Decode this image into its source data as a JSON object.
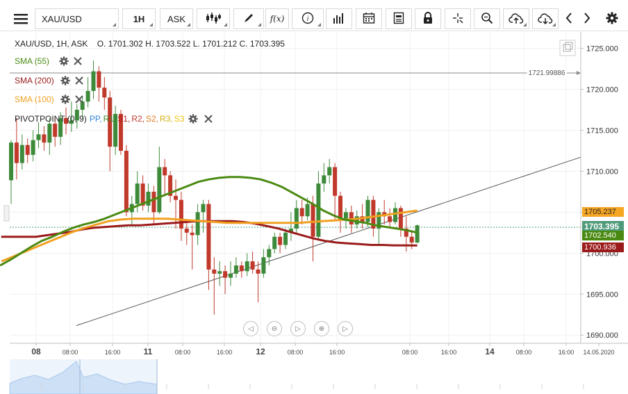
{
  "toolbar": {
    "symbol": "XAU/USD",
    "timeframe": "1H",
    "price_side": "ASK",
    "fx_label": "f(x)"
  },
  "ohlc_line": "XAU/USD, 1H, ASK    O. 1701.302 H. 1703.522 L. 1701.212 C. 1703.395",
  "indicators": {
    "sma55": "SMA (55)",
    "sma200": "SMA (200)",
    "sma100": "SMA (100)",
    "pivot": "PIVOTPOINT (0, 9)",
    "pivot_levels": [
      "PP,",
      "R1,",
      "S1,",
      "R2,",
      "S2,",
      "R3,",
      "S3"
    ]
  },
  "colors": {
    "sma55": "#4a8a12",
    "sma200": "#9b1a1a",
    "sma100": "#f0a020",
    "bull": "#3d8a3a",
    "bear": "#c0392b",
    "pp": "#2e86de",
    "r": "#3a8a2a",
    "s": "#b71c1c",
    "r2": "#c0392b",
    "s2": "#e67e22",
    "r3": "#d4ac0d",
    "s3": "#f1c40f"
  },
  "price_axis": {
    "ticks": [
      "1725.000",
      "1720.000",
      "1715.000",
      "1710.000",
      "1705.000",
      "1700.000",
      "1695.000",
      "1690.000"
    ],
    "tick_values": [
      1725,
      1720,
      1715,
      1710,
      1705,
      1700,
      1695,
      1690
    ],
    "current_price": "1703.395",
    "sma100_price": "1705.237",
    "sma55_price": "1702.540",
    "sma200_price": "1700.936",
    "hline_label": "1721.99886"
  },
  "time_axis": {
    "labels": [
      "08",
      "08:00",
      "16:00",
      "11",
      "08:00",
      "16:00",
      "12",
      "08:00",
      "16:00",
      "08:00",
      "16:00",
      "14",
      "08:00",
      "16:00",
      "14.05.2020"
    ]
  },
  "chart_data": {
    "type": "candlestick",
    "symbol": "XAU/USD",
    "interval": "1H",
    "ylim": [
      1689,
      1727
    ],
    "candles": [
      [
        1708.9,
        1713.5,
        1713.8,
        1706.0
      ],
      [
        1713.5,
        1711.0,
        1716.5,
        1709.0
      ],
      [
        1711.0,
        1713.2,
        1714.5,
        1710.2
      ],
      [
        1713.2,
        1712.0,
        1714.0,
        1711.0
      ],
      [
        1712.0,
        1713.8,
        1715.0,
        1711.2
      ],
      [
        1713.8,
        1714.5,
        1716.0,
        1712.8
      ],
      [
        1714.5,
        1713.5,
        1715.5,
        1712.5
      ],
      [
        1713.5,
        1715.8,
        1716.5,
        1712.0
      ],
      [
        1715.8,
        1714.2,
        1716.5,
        1713.0
      ],
      [
        1714.2,
        1716.5,
        1717.2,
        1713.2
      ],
      [
        1716.5,
        1715.8,
        1717.8,
        1714.5
      ],
      [
        1715.8,
        1716.2,
        1718.5,
        1714.8
      ],
      [
        1716.2,
        1717.5,
        1718.2,
        1715.2
      ],
      [
        1717.5,
        1718.5,
        1719.2,
        1716.5
      ],
      [
        1718.5,
        1719.8,
        1721.5,
        1717.8
      ],
      [
        1719.8,
        1722.2,
        1723.5,
        1718.8
      ],
      [
        1722.2,
        1720.2,
        1722.8,
        1718.5
      ],
      [
        1720.2,
        1719.0,
        1721.5,
        1717.5
      ],
      [
        1719.0,
        1713.0,
        1719.8,
        1710.0
      ],
      [
        1713.0,
        1717.0,
        1718.0,
        1712.0
      ],
      [
        1717.0,
        1712.5,
        1717.5,
        1712.0
      ],
      [
        1712.5,
        1705.0,
        1713.2,
        1704.5
      ],
      [
        1705.0,
        1706.0,
        1707.0,
        1703.5
      ],
      [
        1706.0,
        1708.5,
        1710.0,
        1705.0
      ],
      [
        1708.5,
        1705.8,
        1709.5,
        1705.2
      ],
      [
        1705.8,
        1707.5,
        1708.5,
        1705.0
      ],
      [
        1707.5,
        1705.0,
        1708.2,
        1703.5
      ],
      [
        1705.0,
        1710.5,
        1713.0,
        1704.8
      ],
      [
        1710.5,
        1709.5,
        1711.5,
        1707.0
      ],
      [
        1709.5,
        1707.0,
        1710.0,
        1706.2
      ],
      [
        1707.0,
        1706.5,
        1709.0,
        1703.0
      ],
      [
        1706.5,
        1703.0,
        1707.5,
        1701.5
      ],
      [
        1703.0,
        1702.5,
        1704.0,
        1701.0
      ],
      [
        1702.5,
        1702.2,
        1703.5,
        1698.0
      ],
      [
        1702.2,
        1705.0,
        1706.0,
        1701.0
      ],
      [
        1705.0,
        1706.0,
        1706.5,
        1702.5
      ],
      [
        1706.0,
        1698.0,
        1706.5,
        1695.5
      ],
      [
        1698.0,
        1697.5,
        1699.5,
        1692.5
      ],
      [
        1697.5,
        1697.8,
        1699.0,
        1696.0
      ],
      [
        1697.8,
        1697.0,
        1698.5,
        1695.0
      ],
      [
        1697.0,
        1697.5,
        1699.0,
        1696.0
      ],
      [
        1697.5,
        1698.5,
        1699.5,
        1697.0
      ],
      [
        1698.5,
        1697.8,
        1699.0,
        1697.0
      ],
      [
        1697.8,
        1699.0,
        1700.0,
        1697.2
      ],
      [
        1699.0,
        1698.0,
        1700.2,
        1697.5
      ],
      [
        1698.0,
        1697.5,
        1699.0,
        1694.0
      ],
      [
        1697.5,
        1699.5,
        1700.5,
        1697.0
      ],
      [
        1699.5,
        1700.5,
        1701.0,
        1698.5
      ],
      [
        1700.5,
        1702.0,
        1702.5,
        1700.0
      ],
      [
        1702.0,
        1701.0,
        1702.5,
        1700.0
      ],
      [
        1701.0,
        1702.5,
        1703.0,
        1700.5
      ],
      [
        1702.5,
        1703.0,
        1705.0,
        1701.5
      ],
      [
        1703.0,
        1705.5,
        1706.5,
        1702.5
      ],
      [
        1705.5,
        1704.5,
        1706.5,
        1703.5
      ],
      [
        1704.5,
        1706.0,
        1706.8,
        1704.0
      ],
      [
        1706.0,
        1702.0,
        1707.0,
        1699.0
      ],
      [
        1702.0,
        1708.5,
        1710.0,
        1701.5
      ],
      [
        1708.5,
        1709.5,
        1711.0,
        1707.5
      ],
      [
        1709.5,
        1710.5,
        1711.5,
        1708.5
      ],
      [
        1710.5,
        1707.0,
        1711.0,
        1704.0
      ],
      [
        1707.0,
        1704.0,
        1707.5,
        1702.5
      ],
      [
        1704.0,
        1705.0,
        1705.5,
        1703.0
      ],
      [
        1705.0,
        1703.5,
        1705.8,
        1702.5
      ],
      [
        1703.5,
        1704.5,
        1705.2,
        1703.0
      ],
      [
        1704.5,
        1703.8,
        1706.0,
        1703.0
      ],
      [
        1703.8,
        1706.5,
        1707.0,
        1703.2
      ],
      [
        1706.5,
        1703.0,
        1707.0,
        1702.0
      ],
      [
        1703.0,
        1705.0,
        1705.5,
        1701.0
      ],
      [
        1705.0,
        1704.5,
        1706.5,
        1703.5
      ],
      [
        1704.5,
        1703.8,
        1705.5,
        1703.0
      ],
      [
        1703.8,
        1705.5,
        1706.2,
        1703.5
      ],
      [
        1705.5,
        1703.0,
        1705.8,
        1702.0
      ],
      [
        1703.0,
        1702.0,
        1704.5,
        1700.2
      ],
      [
        1702.0,
        1701.3,
        1702.8,
        1700.5
      ],
      [
        1701.3,
        1703.4,
        1703.5,
        1701.2
      ]
    ],
    "sma55": [
      1698.5,
      1699.2,
      1700.0,
      1700.8,
      1701.5,
      1702.0,
      1702.6,
      1703.1,
      1703.5,
      1703.8,
      1704.2,
      1704.7,
      1705.2,
      1705.7,
      1706.2,
      1706.7,
      1707.2,
      1707.7,
      1708.2,
      1708.7,
      1709.0,
      1709.2,
      1709.3,
      1709.3,
      1709.2,
      1709.0,
      1708.6,
      1708.1,
      1707.4,
      1706.7,
      1706.0,
      1705.2,
      1704.6,
      1704.1,
      1703.9,
      1703.7,
      1703.4,
      1703.2,
      1703.0,
      1702.8,
      1702.5
    ],
    "sma200": [
      1702.0,
      1702.0,
      1702.0,
      1702.0,
      1702.2,
      1702.4,
      1702.6,
      1702.9,
      1703.1,
      1703.2,
      1703.3,
      1703.4,
      1703.4,
      1703.5,
      1703.6,
      1703.7,
      1703.8,
      1703.9,
      1703.9,
      1703.9,
      1703.9,
      1703.8,
      1703.6,
      1703.3,
      1703.0,
      1702.6,
      1702.2,
      1701.8,
      1701.5,
      1701.3,
      1701.2,
      1701.1,
      1701.0,
      1701.0,
      1700.95,
      1700.95,
      1700.94
    ],
    "sma100": [
      1699.0,
      1699.6,
      1700.2,
      1700.8,
      1701.4,
      1702.0,
      1702.6,
      1703.1,
      1703.5,
      1703.9,
      1704.1,
      1704.2,
      1704.2,
      1704.2,
      1704.2,
      1704.1,
      1704.0,
      1703.9,
      1703.8,
      1703.7,
      1703.7,
      1703.7,
      1703.7,
      1703.7,
      1703.7,
      1703.7,
      1703.8,
      1703.9,
      1704.0,
      1704.1,
      1704.2,
      1704.4,
      1704.6,
      1704.8,
      1705.0,
      1705.2
    ],
    "horizontal_line": 1721.99886,
    "trendline": [
      [
        0,
        1688.5
      ],
      [
        76,
        1705.5
      ]
    ]
  }
}
